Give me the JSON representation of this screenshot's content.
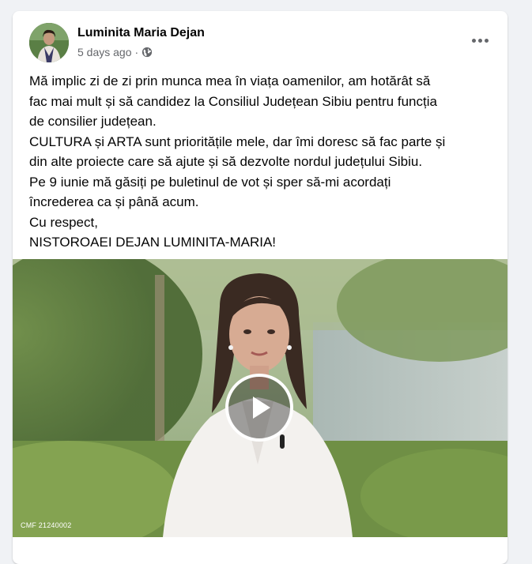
{
  "post": {
    "author": "Luminita Maria Dejan",
    "timestamp": "5 days ago",
    "separator": "·",
    "privacy_icon": "globe-icon",
    "more_icon": "more-options-icon",
    "lines": [
      "Mă implic zi de zi prin munca mea în viața oamenilor, am hotărât să",
      "fac mai mult și să candidez la Consiliul Județean Sibiu pentru funcția",
      "de consilier județean.",
      "CULTURA și ARTA sunt prioritățile mele, dar îmi doresc să fac parte și",
      "din alte proiecte care să ajute și să dezvolte nordul județului Sibiu.",
      "Pe 9 iunie mă găsiți pe buletinul de vot și sper să-mi acordați",
      "încrederea ca și până acum.",
      "Cu respect,",
      "NISTOROAEI DEJAN LUMINITA-MARIA!"
    ]
  },
  "video": {
    "watermark": "CMF 21240002",
    "play_icon": "play-icon"
  },
  "colors": {
    "background": "#f0f2f5",
    "card": "#ffffff",
    "text": "#050505",
    "secondary_text": "#65676b"
  }
}
